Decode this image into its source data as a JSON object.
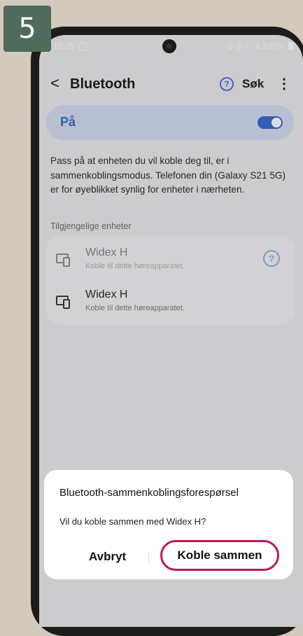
{
  "step_number": "5",
  "status_bar": {
    "time": "13:25",
    "right_indicators": "⊙ ◎ ᵝ⁺.ıl 100%"
  },
  "toolbar": {
    "back_glyph": "<",
    "title": "Bluetooth",
    "help_glyph": "?",
    "search_label": "Søk",
    "more_glyph": "⋮"
  },
  "bluetooth_toggle": {
    "label": "På",
    "state": "on",
    "color": "#2f63c9"
  },
  "info_text": "Pass på at enheten du vil koble deg til, er i sammenkoblingsmodus. Telefonen din (Galaxy S21 5G) er for øyeblikket synlig for enheter i nærheten.",
  "available_devices": {
    "header": "Tilgjengelige enheter",
    "items": [
      {
        "name": "Widex H",
        "subtitle": "Koble til dette høreapparatet.",
        "icon": "hearing-aid-device-icon",
        "help_glyph": "?"
      },
      {
        "name": "Widex H",
        "subtitle": "Koble til dette høreapparatet.",
        "icon": "hearing-aid-device-icon"
      }
    ]
  },
  "pair_dialog": {
    "title": "Bluetooth-sammenkoblingsforespørsel",
    "message": "Vil du koble sammen med Widex H?",
    "cancel_label": "Avbryt",
    "confirm_label": "Koble sammen",
    "highlight_color": "#c0175b"
  },
  "nav_bar": {
    "recent_glyph": "|||",
    "back_glyph": "<"
  },
  "colors": {
    "background": "#d3c9bd",
    "badge": "#4e6b5c",
    "accent": "#2f63c9"
  }
}
